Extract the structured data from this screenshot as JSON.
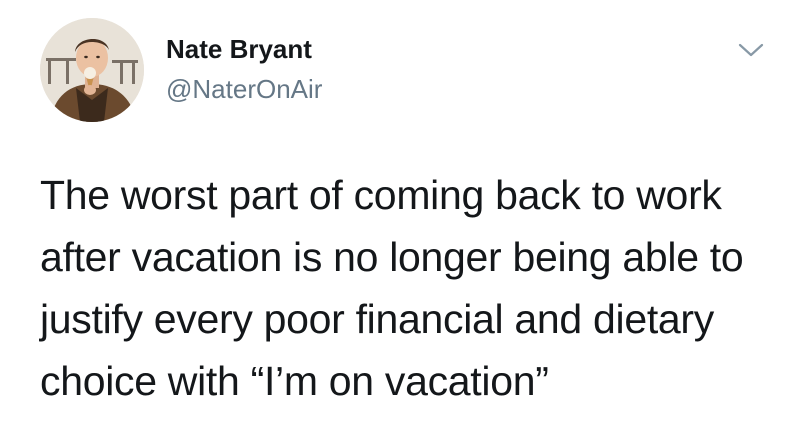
{
  "user": {
    "display_name": "Nate Bryant",
    "handle": "@NaterOnAir",
    "avatar_icon": "profile-photo"
  },
  "menu": {
    "icon": "chevron-down-icon"
  },
  "tweet": {
    "lines": [
      "The worst part of coming back to work",
      "after vacation is no longer being able to",
      "justify every poor financial and dietary",
      "choice with “I’m on vacation”"
    ]
  },
  "colors": {
    "text": "#14171a",
    "secondary": "#657786",
    "background": "#ffffff"
  }
}
